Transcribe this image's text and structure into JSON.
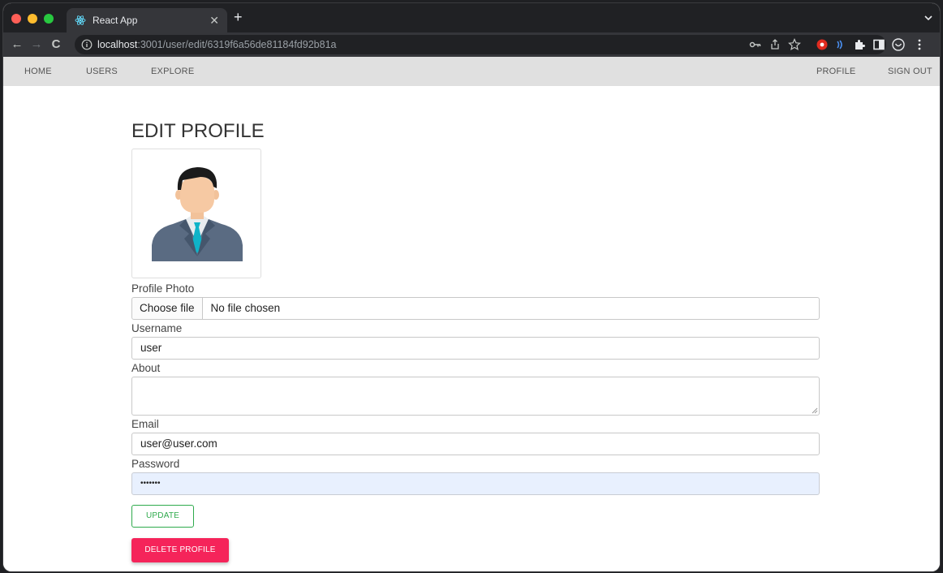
{
  "browser": {
    "tab_title": "React App",
    "url_host": "localhost",
    "url_rest": ":3001/user/edit/6319f6a56de81184fd92b81a"
  },
  "nav": {
    "home": "HOME",
    "users": "USERS",
    "explore": "EXPLORE",
    "profile": "PROFILE",
    "sign_out": "SIGN OUT"
  },
  "page": {
    "title": "EDIT PROFILE"
  },
  "form": {
    "photo_label": "Profile Photo",
    "choose_file": "Choose file",
    "file_status": "No file chosen",
    "username_label": "Username",
    "username_value": "user",
    "about_label": "About",
    "about_value": "",
    "email_label": "Email",
    "email_value": "user@user.com",
    "password_label": "Password",
    "password_value": "•••••••",
    "update_label": "UPDATE",
    "delete_label": "DELETE PROFILE"
  },
  "colors": {
    "nav_bg": "#e0e0e0",
    "update_green": "#2eaa4c",
    "delete_red": "#f5245a",
    "autofill_blue": "#e8f0fe"
  },
  "icons": [
    "react-favicon",
    "info-icon",
    "key-icon",
    "share-icon",
    "star-icon",
    "extension-icon",
    "sidepanel-icon",
    "profile-icon",
    "menu-icon"
  ]
}
